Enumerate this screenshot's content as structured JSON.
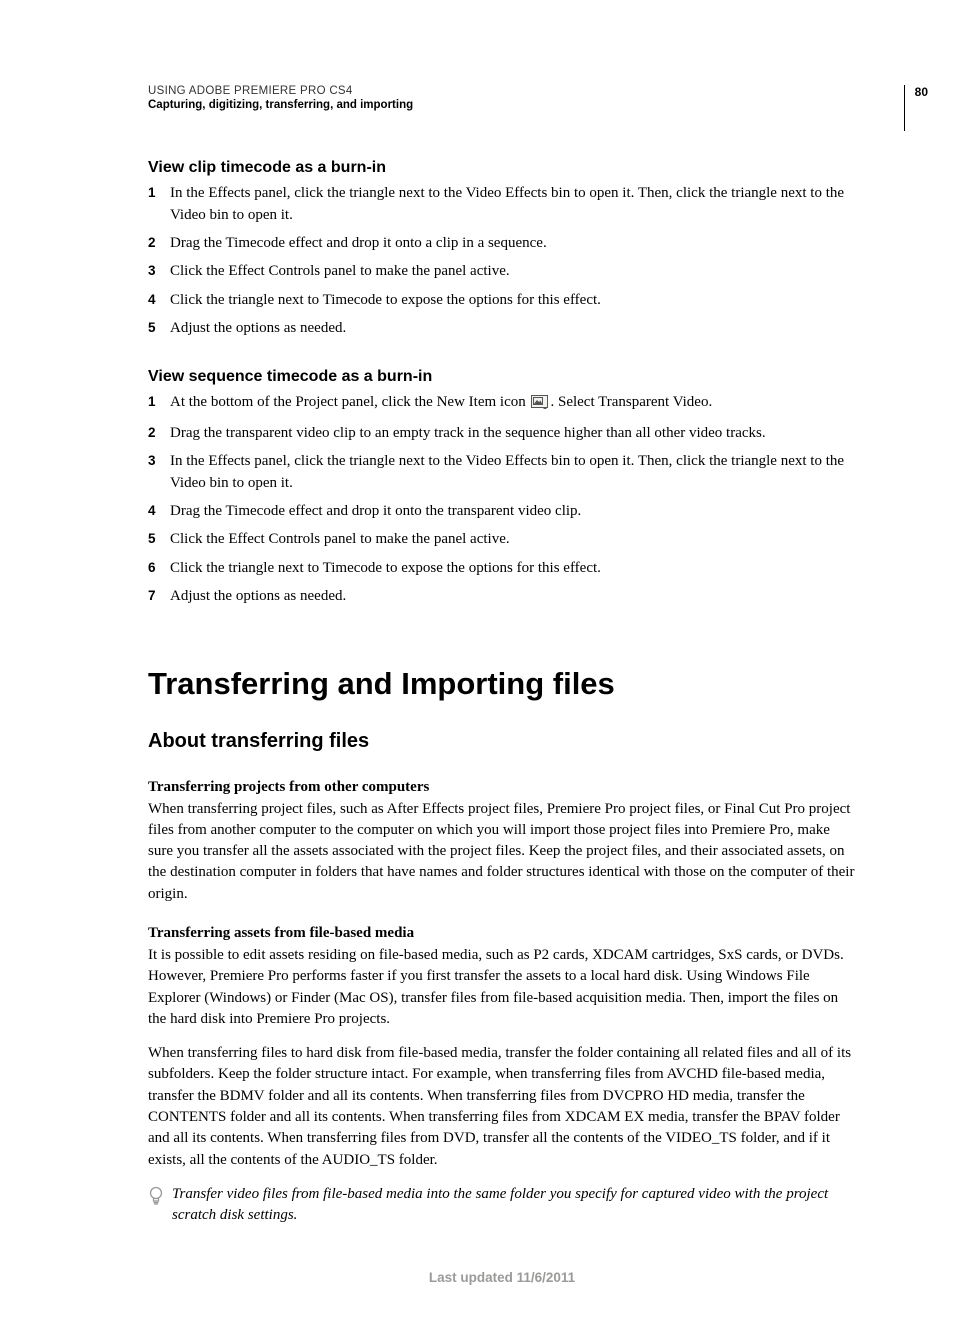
{
  "header": {
    "line1": "USING ADOBE PREMIERE PRO CS4",
    "line2": "Capturing, digitizing, transferring, and importing",
    "page_number": "80"
  },
  "section1": {
    "title": "View clip timecode as a burn-in",
    "steps": [
      "In the Effects panel, click the triangle next to the Video Effects bin to open it. Then, click the triangle next to the Video bin to open it.",
      "Drag the Timecode effect and drop it onto a clip in a sequence.",
      "Click the Effect Controls panel to make the panel active.",
      "Click the triangle next to Timecode to expose the options for this effect.",
      "Adjust the options as needed."
    ]
  },
  "section2": {
    "title": "View sequence timecode as a burn-in",
    "step1_part_a": "At the bottom of the Project panel, click the New Item icon ",
    "step1_part_b": ". Select Transparent Video.",
    "steps_rest": [
      "Drag the transparent video clip to an empty track in the sequence higher than all other video tracks.",
      "In the Effects panel, click the triangle next to the Video Effects bin to open it. Then, click the triangle next to the Video bin to open it.",
      "Drag the Timecode effect and drop it onto the transparent video clip.",
      "Click the Effect Controls panel to make the panel active.",
      "Click the triangle next to Timecode to expose the options for this effect.",
      "Adjust the options as needed."
    ]
  },
  "chapter_title": "Transferring and Importing files",
  "topic_title": "About transferring files",
  "para1": {
    "head": "Transferring projects from other computers",
    "body": "When transferring project files, such as After Effects project files, Premiere Pro project files, or Final Cut Pro project files from another computer to the computer on which you will import those project files into Premiere Pro, make sure you transfer all the assets associated with the project files. Keep the project files, and their associated assets, on the destination computer in folders that have names and folder structures identical with those on the computer of their origin."
  },
  "para2": {
    "head": "Transferring assets from file-based media",
    "body1": "It is possible to edit assets residing on file-based media, such as P2 cards, XDCAM cartridges, SxS cards, or DVDs. However, Premiere Pro performs faster if you first transfer the assets to a local hard disk. Using Windows File Explorer (Windows) or Finder (Mac OS), transfer files from file-based acquisition media. Then, import the files on the hard disk into Premiere Pro projects.",
    "body2": "When transferring files to hard disk from file-based media, transfer the folder containing all related files and all of its subfolders. Keep the folder structure intact. For example, when transferring files from AVCHD file-based media, transfer the BDMV folder and all its contents. When transferring files from DVCPRO HD media, transfer the CONTENTS folder and all its contents. When transferring files from XDCAM EX media, transfer the BPAV folder and all its contents. When transferring files from DVD, transfer all the contents of the VIDEO_TS folder, and if it exists, all the contents of the AUDIO_TS folder."
  },
  "tip": "Transfer video files from file-based media into the same folder you specify for captured video with the project scratch disk settings.",
  "footer": "Last updated 11/6/2011"
}
